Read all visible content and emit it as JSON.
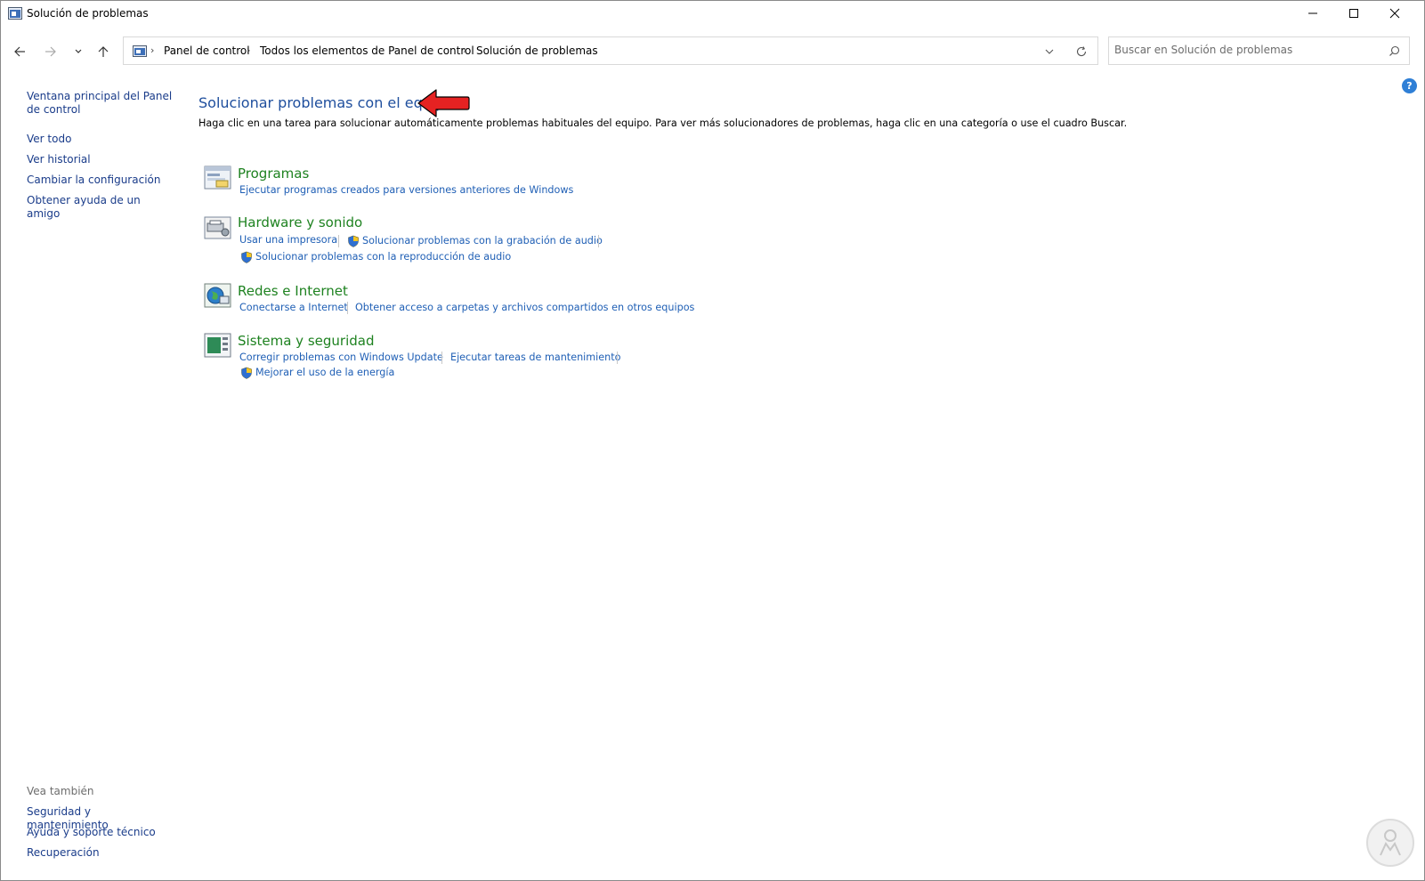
{
  "window": {
    "title": "Solución de problemas"
  },
  "nav": {
    "back_icon": "back-arrow-icon",
    "forward_icon": "forward-arrow-icon",
    "recent_icon": "chevron-down-icon",
    "up_icon": "up-arrow-icon"
  },
  "address": {
    "crumbs": [
      "Panel de control",
      "Todos los elementos de Panel de control",
      "Solución de problemas"
    ]
  },
  "search": {
    "placeholder": "Buscar en Solución de problemas"
  },
  "left_pane": {
    "links": [
      "Ventana principal del Panel de control",
      "Ver todo",
      "Ver historial",
      "Cambiar la configuración",
      "Obtener ayuda de un amigo"
    ],
    "see_also_label": "Vea también",
    "see_also_links": [
      "Seguridad y mantenimiento",
      "Ayuda y soporte técnico",
      "Recuperación"
    ]
  },
  "main": {
    "title": "Solucionar problemas con el equipo",
    "description": "Haga clic en una tarea para solucionar automáticamente problemas habituales del equipo. Para ver más solucionadores de problemas, haga clic en una categoría o use el cuadro Buscar.",
    "categories": [
      {
        "title": "Programas",
        "icon": "programs-icon",
        "tasks": [
          "Ejecutar programas creados para versiones anteriores de Windows"
        ]
      },
      {
        "title": "Hardware y sonido",
        "icon": "hardware-sound-icon",
        "tasks": [
          "Usar una impresora",
          "Solucionar problemas con la grabación de audio",
          "Solucionar problemas con la reproducción de audio"
        ]
      },
      {
        "title": "Redes e Internet",
        "icon": "network-internet-icon",
        "tasks": [
          "Conectarse a Internet",
          "Obtener acceso a carpetas y archivos compartidos en otros equipos"
        ]
      },
      {
        "title": "Sistema y seguridad",
        "icon": "system-security-icon",
        "tasks": [
          "Corregir problemas con Windows Update",
          "Ejecutar tareas de mantenimiento",
          "Mejorar el uso de la energía"
        ]
      }
    ]
  },
  "colors": {
    "link_blue": "#1f5fb5",
    "title_blue": "#1e4e9d",
    "category_green": "#1e8220",
    "arrow_red": "#e52222"
  }
}
